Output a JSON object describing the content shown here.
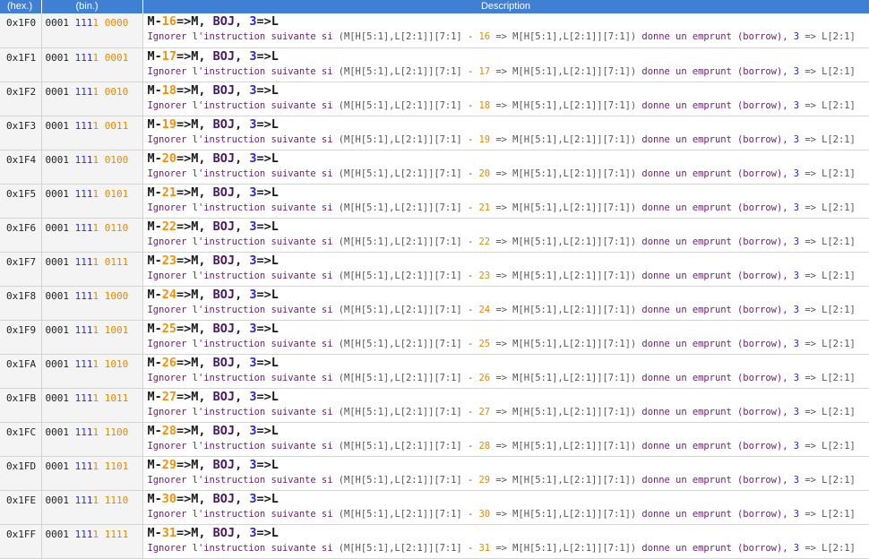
{
  "header": {
    "hex_label": "(hex.)",
    "bin_label": "(bin.)",
    "desc_label": "Description"
  },
  "rows": [
    {
      "hex": "0x1F0",
      "bin_hi": "0001",
      "bin_mid": "111",
      "bin_bit": "1",
      "bin_lo": "0000",
      "offset": "16"
    },
    {
      "hex": "0x1F1",
      "bin_hi": "0001",
      "bin_mid": "111",
      "bin_bit": "1",
      "bin_lo": "0001",
      "offset": "17"
    },
    {
      "hex": "0x1F2",
      "bin_hi": "0001",
      "bin_mid": "111",
      "bin_bit": "1",
      "bin_lo": "0010",
      "offset": "18"
    },
    {
      "hex": "0x1F3",
      "bin_hi": "0001",
      "bin_mid": "111",
      "bin_bit": "1",
      "bin_lo": "0011",
      "offset": "19"
    },
    {
      "hex": "0x1F4",
      "bin_hi": "0001",
      "bin_mid": "111",
      "bin_bit": "1",
      "bin_lo": "0100",
      "offset": "20"
    },
    {
      "hex": "0x1F5",
      "bin_hi": "0001",
      "bin_mid": "111",
      "bin_bit": "1",
      "bin_lo": "0101",
      "offset": "21"
    },
    {
      "hex": "0x1F6",
      "bin_hi": "0001",
      "bin_mid": "111",
      "bin_bit": "1",
      "bin_lo": "0110",
      "offset": "22"
    },
    {
      "hex": "0x1F7",
      "bin_hi": "0001",
      "bin_mid": "111",
      "bin_bit": "1",
      "bin_lo": "0111",
      "offset": "23"
    },
    {
      "hex": "0x1F8",
      "bin_hi": "0001",
      "bin_mid": "111",
      "bin_bit": "1",
      "bin_lo": "1000",
      "offset": "24"
    },
    {
      "hex": "0x1F9",
      "bin_hi": "0001",
      "bin_mid": "111",
      "bin_bit": "1",
      "bin_lo": "1001",
      "offset": "25"
    },
    {
      "hex": "0x1FA",
      "bin_hi": "0001",
      "bin_mid": "111",
      "bin_bit": "1",
      "bin_lo": "1010",
      "offset": "26"
    },
    {
      "hex": "0x1FB",
      "bin_hi": "0001",
      "bin_mid": "111",
      "bin_bit": "1",
      "bin_lo": "1011",
      "offset": "27"
    },
    {
      "hex": "0x1FC",
      "bin_hi": "0001",
      "bin_mid": "111",
      "bin_bit": "1",
      "bin_lo": "1100",
      "offset": "28"
    },
    {
      "hex": "0x1FD",
      "bin_hi": "0001",
      "bin_mid": "111",
      "bin_bit": "1",
      "bin_lo": "1101",
      "offset": "29"
    },
    {
      "hex": "0x1FE",
      "bin_hi": "0001",
      "bin_mid": "111",
      "bin_bit": "1",
      "bin_lo": "1110",
      "offset": "30"
    },
    {
      "hex": "0x1FF",
      "bin_hi": "0001",
      "bin_mid": "111",
      "bin_bit": "1",
      "bin_lo": "1111",
      "offset": "31"
    }
  ],
  "mnemonic": {
    "prefix": "M-",
    "dest": "=>M, ",
    "op": "BOJ",
    "sep": ", ",
    "reg": "3",
    "tail": "=>L"
  },
  "detail": {
    "intro": "Ignorer l'instruction suivante si ",
    "expr": "(M[H[5:1],L[2:1]][7:1] - ",
    "mid": " => M[H[5:1],L[2:1]][7:1]) ",
    "cond": "donne un emprunt (borrow), ",
    "reg": "3",
    "tail": " => L[2:1]"
  },
  "colors": {
    "header_bg": "#3f7fd4",
    "number": "#f0900c",
    "opcode": "#4a1466",
    "register": "#2828c8",
    "text": "#6a1f6e"
  }
}
